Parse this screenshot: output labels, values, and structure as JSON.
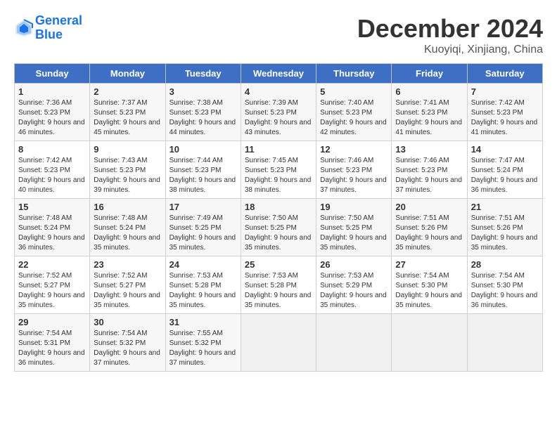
{
  "header": {
    "logo_line1": "General",
    "logo_line2": "Blue",
    "month": "December 2024",
    "location": "Kuoyiqi, Xinjiang, China"
  },
  "weekdays": [
    "Sunday",
    "Monday",
    "Tuesday",
    "Wednesday",
    "Thursday",
    "Friday",
    "Saturday"
  ],
  "weeks": [
    [
      {
        "day": "1",
        "sunrise": "Sunrise: 7:36 AM",
        "sunset": "Sunset: 5:23 PM",
        "daylight": "Daylight: 9 hours and 46 minutes."
      },
      {
        "day": "2",
        "sunrise": "Sunrise: 7:37 AM",
        "sunset": "Sunset: 5:23 PM",
        "daylight": "Daylight: 9 hours and 45 minutes."
      },
      {
        "day": "3",
        "sunrise": "Sunrise: 7:38 AM",
        "sunset": "Sunset: 5:23 PM",
        "daylight": "Daylight: 9 hours and 44 minutes."
      },
      {
        "day": "4",
        "sunrise": "Sunrise: 7:39 AM",
        "sunset": "Sunset: 5:23 PM",
        "daylight": "Daylight: 9 hours and 43 minutes."
      },
      {
        "day": "5",
        "sunrise": "Sunrise: 7:40 AM",
        "sunset": "Sunset: 5:23 PM",
        "daylight": "Daylight: 9 hours and 42 minutes."
      },
      {
        "day": "6",
        "sunrise": "Sunrise: 7:41 AM",
        "sunset": "Sunset: 5:23 PM",
        "daylight": "Daylight: 9 hours and 41 minutes."
      },
      {
        "day": "7",
        "sunrise": "Sunrise: 7:42 AM",
        "sunset": "Sunset: 5:23 PM",
        "daylight": "Daylight: 9 hours and 41 minutes."
      }
    ],
    [
      {
        "day": "8",
        "sunrise": "Sunrise: 7:42 AM",
        "sunset": "Sunset: 5:23 PM",
        "daylight": "Daylight: 9 hours and 40 minutes."
      },
      {
        "day": "9",
        "sunrise": "Sunrise: 7:43 AM",
        "sunset": "Sunset: 5:23 PM",
        "daylight": "Daylight: 9 hours and 39 minutes."
      },
      {
        "day": "10",
        "sunrise": "Sunrise: 7:44 AM",
        "sunset": "Sunset: 5:23 PM",
        "daylight": "Daylight: 9 hours and 38 minutes."
      },
      {
        "day": "11",
        "sunrise": "Sunrise: 7:45 AM",
        "sunset": "Sunset: 5:23 PM",
        "daylight": "Daylight: 9 hours and 38 minutes."
      },
      {
        "day": "12",
        "sunrise": "Sunrise: 7:46 AM",
        "sunset": "Sunset: 5:23 PM",
        "daylight": "Daylight: 9 hours and 37 minutes."
      },
      {
        "day": "13",
        "sunrise": "Sunrise: 7:46 AM",
        "sunset": "Sunset: 5:23 PM",
        "daylight": "Daylight: 9 hours and 37 minutes."
      },
      {
        "day": "14",
        "sunrise": "Sunrise: 7:47 AM",
        "sunset": "Sunset: 5:24 PM",
        "daylight": "Daylight: 9 hours and 36 minutes."
      }
    ],
    [
      {
        "day": "15",
        "sunrise": "Sunrise: 7:48 AM",
        "sunset": "Sunset: 5:24 PM",
        "daylight": "Daylight: 9 hours and 36 minutes."
      },
      {
        "day": "16",
        "sunrise": "Sunrise: 7:48 AM",
        "sunset": "Sunset: 5:24 PM",
        "daylight": "Daylight: 9 hours and 35 minutes."
      },
      {
        "day": "17",
        "sunrise": "Sunrise: 7:49 AM",
        "sunset": "Sunset: 5:25 PM",
        "daylight": "Daylight: 9 hours and 35 minutes."
      },
      {
        "day": "18",
        "sunrise": "Sunrise: 7:50 AM",
        "sunset": "Sunset: 5:25 PM",
        "daylight": "Daylight: 9 hours and 35 minutes."
      },
      {
        "day": "19",
        "sunrise": "Sunrise: 7:50 AM",
        "sunset": "Sunset: 5:25 PM",
        "daylight": "Daylight: 9 hours and 35 minutes."
      },
      {
        "day": "20",
        "sunrise": "Sunrise: 7:51 AM",
        "sunset": "Sunset: 5:26 PM",
        "daylight": "Daylight: 9 hours and 35 minutes."
      },
      {
        "day": "21",
        "sunrise": "Sunrise: 7:51 AM",
        "sunset": "Sunset: 5:26 PM",
        "daylight": "Daylight: 9 hours and 35 minutes."
      }
    ],
    [
      {
        "day": "22",
        "sunrise": "Sunrise: 7:52 AM",
        "sunset": "Sunset: 5:27 PM",
        "daylight": "Daylight: 9 hours and 35 minutes."
      },
      {
        "day": "23",
        "sunrise": "Sunrise: 7:52 AM",
        "sunset": "Sunset: 5:27 PM",
        "daylight": "Daylight: 9 hours and 35 minutes."
      },
      {
        "day": "24",
        "sunrise": "Sunrise: 7:53 AM",
        "sunset": "Sunset: 5:28 PM",
        "daylight": "Daylight: 9 hours and 35 minutes."
      },
      {
        "day": "25",
        "sunrise": "Sunrise: 7:53 AM",
        "sunset": "Sunset: 5:28 PM",
        "daylight": "Daylight: 9 hours and 35 minutes."
      },
      {
        "day": "26",
        "sunrise": "Sunrise: 7:53 AM",
        "sunset": "Sunset: 5:29 PM",
        "daylight": "Daylight: 9 hours and 35 minutes."
      },
      {
        "day": "27",
        "sunrise": "Sunrise: 7:54 AM",
        "sunset": "Sunset: 5:30 PM",
        "daylight": "Daylight: 9 hours and 35 minutes."
      },
      {
        "day": "28",
        "sunrise": "Sunrise: 7:54 AM",
        "sunset": "Sunset: 5:30 PM",
        "daylight": "Daylight: 9 hours and 36 minutes."
      }
    ],
    [
      {
        "day": "29",
        "sunrise": "Sunrise: 7:54 AM",
        "sunset": "Sunset: 5:31 PM",
        "daylight": "Daylight: 9 hours and 36 minutes."
      },
      {
        "day": "30",
        "sunrise": "Sunrise: 7:54 AM",
        "sunset": "Sunset: 5:32 PM",
        "daylight": "Daylight: 9 hours and 37 minutes."
      },
      {
        "day": "31",
        "sunrise": "Sunrise: 7:55 AM",
        "sunset": "Sunset: 5:32 PM",
        "daylight": "Daylight: 9 hours and 37 minutes."
      },
      null,
      null,
      null,
      null
    ]
  ]
}
